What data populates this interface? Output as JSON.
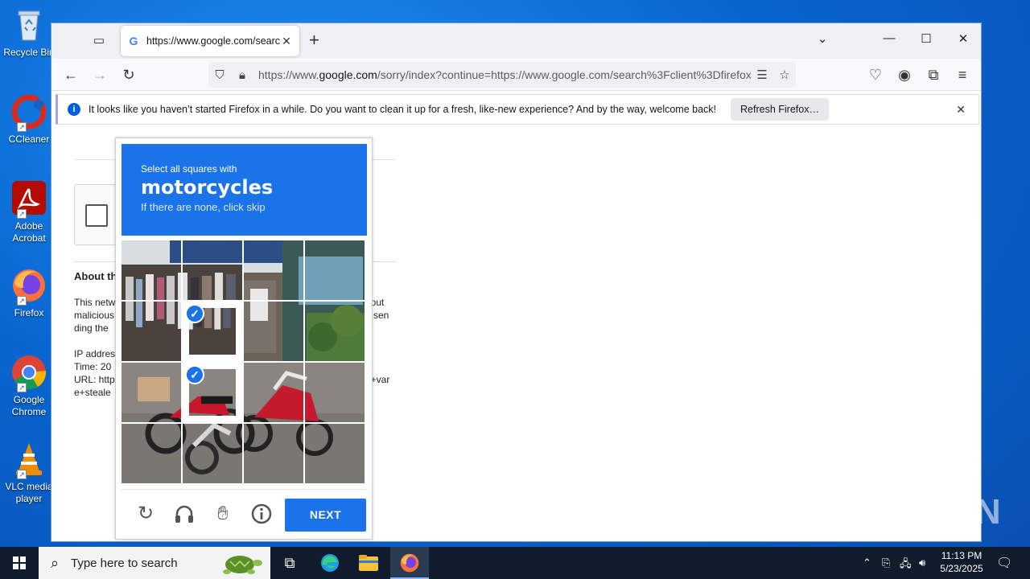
{
  "desktop": {
    "icons": [
      {
        "label": "Recycle Bin",
        "icon": "recycle-bin-icon"
      },
      {
        "label": "CCleaner",
        "icon": "ccleaner-icon"
      },
      {
        "label": "Adobe Acrobat",
        "icon": "acrobat-icon"
      },
      {
        "label": "Firefox",
        "icon": "firefox-icon"
      },
      {
        "label": "Google Chrome",
        "icon": "chrome-icon"
      },
      {
        "label": "VLC media player",
        "icon": "vlc-icon"
      }
    ]
  },
  "browser": {
    "tab_title": "https://www.google.com/search",
    "url_prefix": "https://www.",
    "url_domain": "google.com",
    "url_rest": "/sorry/index?continue=https://www.google.com/search%3Fclient%3Dfirefox",
    "notification": {
      "message": "It looks like you haven’t started Firefox in a while. Do you want to clean it up for a fresh, like-new experience? And by the way, welcome back!",
      "button": "Refresh Firefox…"
    }
  },
  "page": {
    "heading_fragment": "About th",
    "line1": "This netw",
    "line1_right": "bout",
    "line2": "malicious",
    "line2_right": "n sen",
    "line3": "ding the",
    "ip_label": "IP addres",
    "time_label": "Time: 20",
    "url_label": "URL: http",
    "url_right": "o+var",
    "url_line2": "e+steale"
  },
  "captcha": {
    "instruction": "Select all squares with",
    "target": "motorcycles",
    "hint": "If there are none, click skip",
    "selected_tiles": [
      5,
      9
    ],
    "next_label": "NEXT",
    "footer_icons": [
      "reload-icon",
      "audio-icon",
      "hand-icon",
      "info-icon"
    ]
  },
  "watermark": "ANY RUN",
  "taskbar": {
    "search_placeholder": "Type here to search",
    "time": "11:13 PM",
    "date": "5/23/2025"
  }
}
